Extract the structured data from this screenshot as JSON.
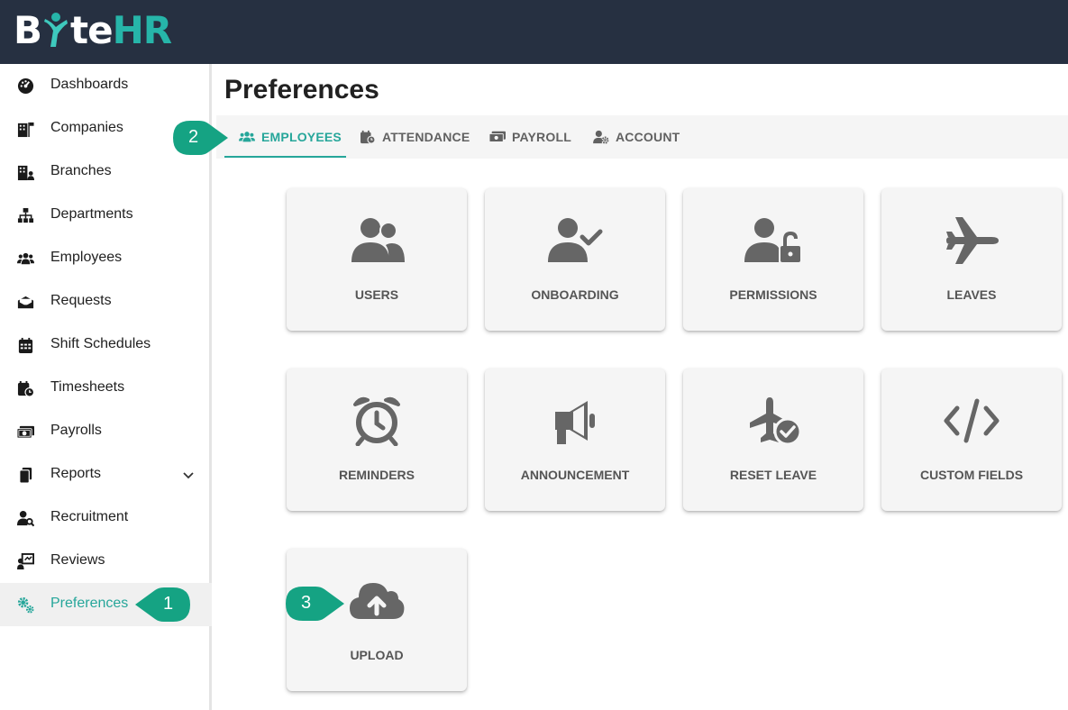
{
  "app": {
    "logo_left": "B",
    "logo_right_dark": "te",
    "logo_right_teal": "HR",
    "accent_color": "#26a69a",
    "topbar_color": "#263041"
  },
  "sidebar": {
    "items": [
      {
        "label": "Dashboards",
        "icon": "gauge-icon"
      },
      {
        "label": "Companies",
        "icon": "building-flag-icon"
      },
      {
        "label": "Branches",
        "icon": "building-user-icon"
      },
      {
        "label": "Departments",
        "icon": "sitemap-icon"
      },
      {
        "label": "Employees",
        "icon": "users-icon"
      },
      {
        "label": "Requests",
        "icon": "envelope-open-icon"
      },
      {
        "label": "Shift Schedules",
        "icon": "calendar-icon"
      },
      {
        "label": "Timesheets",
        "icon": "calendar-clock-icon"
      },
      {
        "label": "Payrolls",
        "icon": "money-bill-icon"
      },
      {
        "label": "Reports",
        "icon": "file-copy-icon"
      },
      {
        "label": "Recruitment",
        "icon": "user-search-icon"
      },
      {
        "label": "Reviews",
        "icon": "chalkboard-user-icon"
      },
      {
        "label": "Preferences",
        "icon": "gears-icon"
      }
    ],
    "active": "Preferences"
  },
  "page": {
    "title": "Preferences"
  },
  "tabs": [
    {
      "label": "EMPLOYEES",
      "icon": "users-icon"
    },
    {
      "label": "ATTENDANCE",
      "icon": "calendar-clock-icon"
    },
    {
      "label": "PAYROLL",
      "icon": "money-bill-icon"
    },
    {
      "label": "ACCOUNT",
      "icon": "user-gear-icon"
    }
  ],
  "active_tab": "EMPLOYEES",
  "cards": [
    {
      "label": "USERS",
      "icon": "users-icon"
    },
    {
      "label": "ONBOARDING",
      "icon": "user-check-icon"
    },
    {
      "label": "PERMISSIONS",
      "icon": "user-lock-icon"
    },
    {
      "label": "LEAVES",
      "icon": "plane-icon"
    },
    {
      "label": "REMINDERS",
      "icon": "alarm-clock-icon"
    },
    {
      "label": "ANNOUNCEMENT",
      "icon": "bullhorn-icon"
    },
    {
      "label": "RESET LEAVE",
      "icon": "plane-circle-check-icon"
    },
    {
      "label": "CUSTOM FIELDS",
      "icon": "code-icon"
    },
    {
      "label": "UPLOAD",
      "icon": "cloud-upload-icon"
    }
  ],
  "callouts": [
    "1",
    "2",
    "3"
  ]
}
